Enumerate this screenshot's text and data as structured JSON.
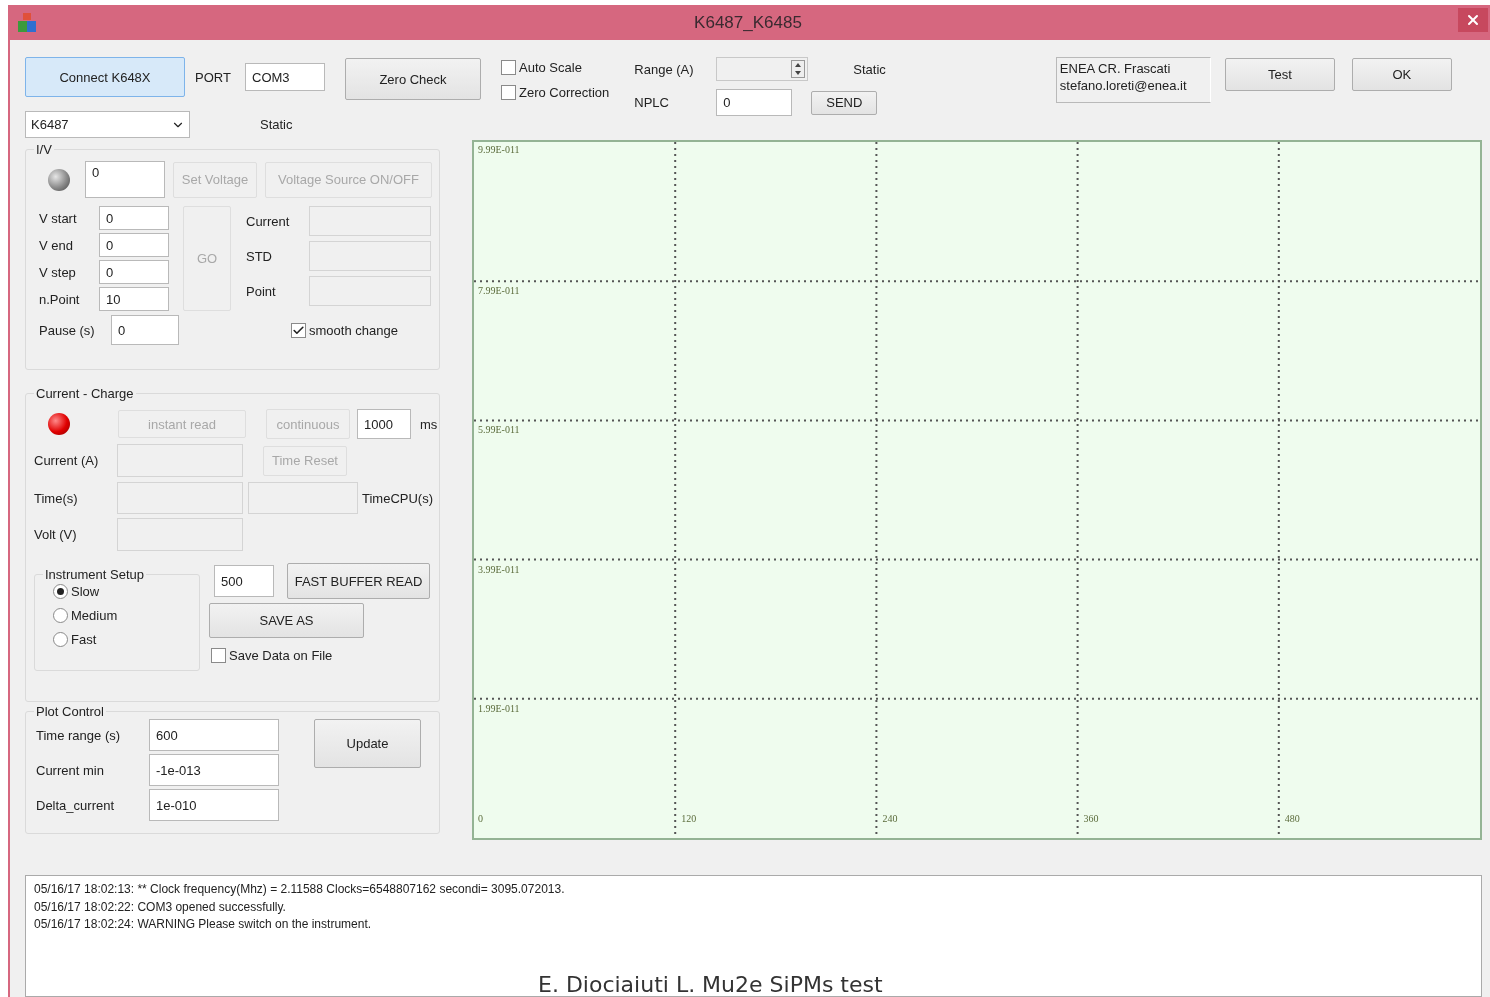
{
  "window": {
    "title": "K6487_K6485"
  },
  "toolbar": {
    "connect_button": "Connect K648X",
    "port_label": "PORT",
    "port": "COM3",
    "model": "K6487",
    "model_status": "Static",
    "zero_check_button": "Zero Check",
    "checkboxes": [
      {
        "label": "Auto Scale",
        "checked": false
      },
      {
        "label": "Zero Correction",
        "checked": false
      }
    ],
    "range_label": "Range (A)",
    "range_status": "Static",
    "nplc_label": "NPLC",
    "nplc": "0",
    "send_button": "SEND",
    "info": [
      "ENEA CR. Frascati",
      "stefano.loreti@enea.it"
    ],
    "test_button": "Test",
    "ok_button": "OK"
  },
  "iv": {
    "title": "I/V",
    "led_on": false,
    "voltage": "0",
    "set_voltage_button": {
      "label": "Set Voltage",
      "disabled": true
    },
    "source_button": {
      "label": "Voltage Source ON/OFF",
      "disabled": true
    },
    "fields": [
      {
        "label": "V start",
        "value": "0"
      },
      {
        "label": "V end",
        "value": "0"
      },
      {
        "label": "V step",
        "value": "0"
      },
      {
        "label": "n.Point",
        "value": "10"
      }
    ],
    "go_button": {
      "label": "GO",
      "disabled": true
    },
    "readouts": [
      "Current",
      "STD",
      "Point"
    ],
    "pause": {
      "label": "Pause (s)",
      "value": "0"
    },
    "smooth_change": {
      "label": "smooth  change",
      "checked": true
    }
  },
  "current_charge": {
    "title": "Current - Charge",
    "led_on": true,
    "instant_read_button": {
      "label": "instant read",
      "disabled": true
    },
    "continuous_button": {
      "label": "continuous",
      "disabled": true
    },
    "interval": "1000",
    "interval_unit": "ms",
    "time_reset_button": {
      "label": "Time Reset",
      "disabled": true
    },
    "current_label": "Current (A)",
    "time_label": "Time(s)",
    "time_cpu_label": "TimeCPU(s)",
    "volt_label": "Volt (V)",
    "setup": {
      "title": "Instrument Setup",
      "options": [
        {
          "label": "Slow",
          "selected": true
        },
        {
          "label": "Medium",
          "selected": false
        },
        {
          "label": "Fast",
          "selected": false
        }
      ]
    },
    "buffer_size": "500",
    "fast_buffer_button": "FAST BUFFER READ",
    "save_as_button": "SAVE AS",
    "save_data": {
      "label": "Save Data on File",
      "checked": false
    }
  },
  "plot_control": {
    "title": "Plot Control",
    "fields": [
      {
        "label": "Time range (s)",
        "value": "600"
      },
      {
        "label": "Current min",
        "value": "-1e-013"
      },
      {
        "label": "Delta_current",
        "value": "1e-010"
      }
    ],
    "update_button": "Update"
  },
  "plot": {
    "y_labels": [
      "9.99E-011",
      "7.99E-011",
      "5.99E-011",
      "3.99E-011",
      "1.99E-011"
    ],
    "x_labels": [
      "0",
      "120",
      "240",
      "360",
      "480"
    ]
  },
  "log": [
    "05/16/17 18:02:13:  ** Clock frequency(Mhz) = 2.11588  Clocks=6548807162 secondi=  3095.072013.",
    "05/16/17 18:02:22: COM3 opened successfully.",
    "05/16/17 18:02:24: WARNING Please switch on the instrument."
  ],
  "footer": "E. Diociaiuti L. Mu2e SiPMs test"
}
